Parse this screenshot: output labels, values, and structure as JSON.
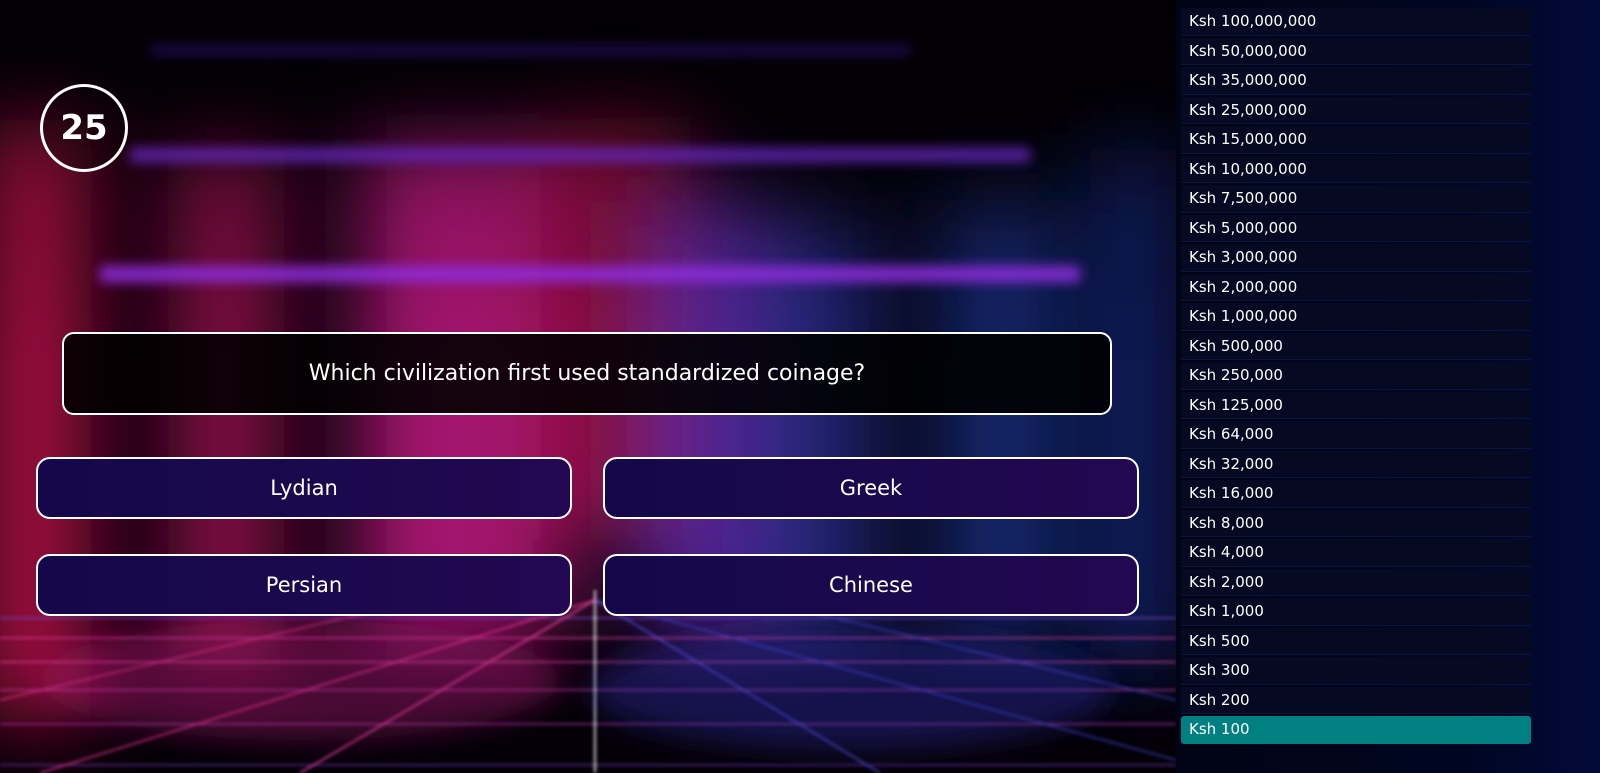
{
  "timer": {
    "value": "25"
  },
  "question": {
    "text": "Which civilization first used standardized coinage?"
  },
  "answers": [
    {
      "label": "Lydian"
    },
    {
      "label": "Greek"
    },
    {
      "label": "Persian"
    },
    {
      "label": "Chinese"
    }
  ],
  "prize_ladder": {
    "currency": "Ksh",
    "levels": [
      "Ksh 100,000,000",
      "Ksh 50,000,000",
      "Ksh 35,000,000",
      "Ksh 25,000,000",
      "Ksh 15,000,000",
      "Ksh 10,000,000",
      "Ksh 7,500,000",
      "Ksh 5,000,000",
      "Ksh 3,000,000",
      "Ksh 2,000,000",
      "Ksh 1,000,000",
      "Ksh 500,000",
      "Ksh 250,000",
      "Ksh 125,000",
      "Ksh 64,000",
      "Ksh 32,000",
      "Ksh 16,000",
      "Ksh 8,000",
      "Ksh 4,000",
      "Ksh 2,000",
      "Ksh 1,000",
      "Ksh 500",
      "Ksh 300",
      "Ksh 200",
      "Ksh 100"
    ],
    "current_level": "Ksh 100"
  },
  "colors": {
    "current_level_highlight": "#008080",
    "answer_fill": "#1a0850",
    "panel_background": "#000622"
  }
}
